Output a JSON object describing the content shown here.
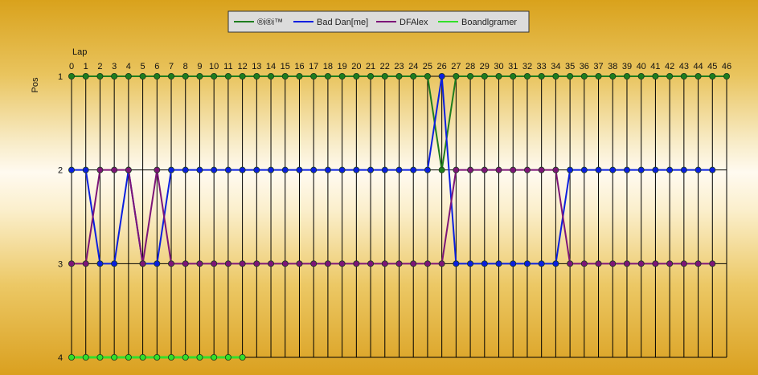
{
  "chart_data": {
    "type": "line",
    "xlabel": "Lap",
    "ylabel": "Pos",
    "x": [
      0,
      1,
      2,
      3,
      4,
      5,
      6,
      7,
      8,
      9,
      10,
      11,
      12,
      13,
      14,
      15,
      16,
      17,
      18,
      19,
      20,
      21,
      22,
      23,
      24,
      25,
      26,
      27,
      28,
      29,
      30,
      31,
      32,
      33,
      34,
      35,
      36,
      37,
      38,
      39,
      40,
      41,
      42,
      43,
      44,
      45,
      46
    ],
    "xlim": [
      0,
      46
    ],
    "ylim": [
      1,
      4
    ],
    "y_ticks": [
      1,
      2,
      3,
      4
    ],
    "y_reversed": true,
    "grid": "vertical per lap, horizontal per position",
    "legend_position": "top-center",
    "series": [
      {
        "name": "®i®i™",
        "color": "#1e7d1e",
        "laps": [
          0,
          1,
          2,
          3,
          4,
          5,
          6,
          7,
          8,
          9,
          10,
          11,
          12,
          13,
          14,
          15,
          16,
          17,
          18,
          19,
          20,
          21,
          22,
          23,
          24,
          25,
          26,
          27,
          28,
          29,
          30,
          31,
          32,
          33,
          34,
          35,
          36,
          37,
          38,
          39,
          40,
          41,
          42,
          43,
          44,
          45,
          46
        ],
        "positions": [
          1,
          1,
          1,
          1,
          1,
          1,
          1,
          1,
          1,
          1,
          1,
          1,
          1,
          1,
          1,
          1,
          1,
          1,
          1,
          1,
          1,
          1,
          1,
          1,
          1,
          1,
          2,
          1,
          1,
          1,
          1,
          1,
          1,
          1,
          1,
          1,
          1,
          1,
          1,
          1,
          1,
          1,
          1,
          1,
          1,
          1,
          1
        ]
      },
      {
        "name": "Bad Dan[me]",
        "color": "#0a1fe0",
        "laps": [
          0,
          1,
          2,
          3,
          4,
          5,
          6,
          7,
          8,
          9,
          10,
          11,
          12,
          13,
          14,
          15,
          16,
          17,
          18,
          19,
          20,
          21,
          22,
          23,
          24,
          25,
          26,
          27,
          28,
          29,
          30,
          31,
          32,
          33,
          34,
          35,
          36,
          37,
          38,
          39,
          40,
          41,
          42,
          43,
          44,
          45
        ],
        "positions": [
          2,
          2,
          3,
          3,
          2,
          3,
          3,
          2,
          2,
          2,
          2,
          2,
          2,
          2,
          2,
          2,
          2,
          2,
          2,
          2,
          2,
          2,
          2,
          2,
          2,
          2,
          1,
          3,
          3,
          3,
          3,
          3,
          3,
          3,
          3,
          2,
          2,
          2,
          2,
          2,
          2,
          2,
          2,
          2,
          2,
          2
        ]
      },
      {
        "name": "DFAlex",
        "color": "#7d1578",
        "laps": [
          0,
          1,
          2,
          3,
          4,
          5,
          6,
          7,
          8,
          9,
          10,
          11,
          12,
          13,
          14,
          15,
          16,
          17,
          18,
          19,
          20,
          21,
          22,
          23,
          24,
          25,
          26,
          27,
          28,
          29,
          30,
          31,
          32,
          33,
          34,
          35,
          36,
          37,
          38,
          39,
          40,
          41,
          42,
          43,
          44,
          45
        ],
        "positions": [
          3,
          3,
          2,
          2,
          2,
          3,
          2,
          3,
          3,
          3,
          3,
          3,
          3,
          3,
          3,
          3,
          3,
          3,
          3,
          3,
          3,
          3,
          3,
          3,
          3,
          3,
          3,
          2,
          2,
          2,
          2,
          2,
          2,
          2,
          2,
          3,
          3,
          3,
          3,
          3,
          3,
          3,
          3,
          3,
          3,
          3
        ]
      },
      {
        "name": "Boandlgramer",
        "color": "#33e02a",
        "laps": [
          0,
          1,
          2,
          3,
          4,
          5,
          6,
          7,
          8,
          9,
          10,
          11,
          12
        ],
        "positions": [
          4,
          4,
          4,
          4,
          4,
          4,
          4,
          4,
          4,
          4,
          4,
          4,
          4
        ]
      }
    ]
  }
}
